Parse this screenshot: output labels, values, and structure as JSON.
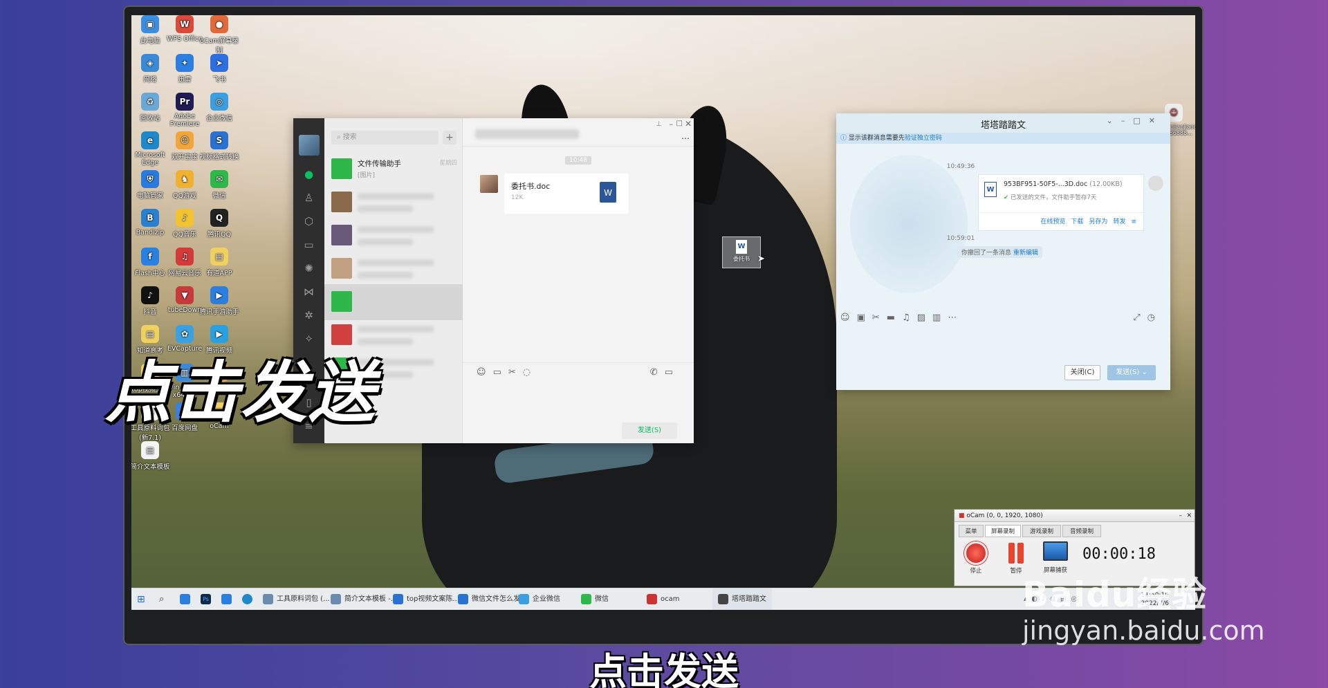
{
  "desktop_icons": [
    {
      "label": "此电脑",
      "color": "#3b8de0",
      "glyph": "▣"
    },
    {
      "label": "WPS Office",
      "color": "#d94a3a",
      "glyph": "W"
    },
    {
      "label": "oCam屏幕录制",
      "color": "#e06a3a",
      "glyph": "●"
    },
    {
      "label": "网络",
      "color": "#3a8ad8",
      "glyph": "◈"
    },
    {
      "label": "迅雷",
      "color": "#2a7fe0",
      "glyph": "✦"
    },
    {
      "label": "飞书",
      "color": "#2d6fe0",
      "glyph": "➤"
    },
    {
      "label": "回收站",
      "color": "#6aa8d8",
      "glyph": "♻"
    },
    {
      "label": "Adobe Premiere",
      "color": "#1f1b55",
      "glyph": "Pr"
    },
    {
      "label": "企业微信",
      "color": "#3a9ee0",
      "glyph": "◎"
    },
    {
      "label": "Microsoft Edge",
      "color": "#1e88c8",
      "glyph": "e"
    },
    {
      "label": "双开宝宝",
      "color": "#f2a53a",
      "glyph": "☺"
    },
    {
      "label": "视频格式转换",
      "color": "#2a72d0",
      "glyph": "S"
    },
    {
      "label": "电脑管家",
      "color": "#2a7be0",
      "glyph": "⛨"
    },
    {
      "label": "QQ游戏",
      "color": "#f0b030",
      "glyph": "♞"
    },
    {
      "label": "微信",
      "color": "#2fb84a",
      "glyph": "✉"
    },
    {
      "label": "Bandizip",
      "color": "#2a7fd0",
      "glyph": "B"
    },
    {
      "label": "QQ音乐",
      "color": "#f2c230",
      "glyph": "♪"
    },
    {
      "label": "腾讯QQ",
      "color": "#222",
      "glyph": "Q"
    },
    {
      "label": "Flash中心",
      "color": "#2a80e0",
      "glyph": "f"
    },
    {
      "label": "网易云音乐",
      "color": "#d33a3a",
      "glyph": "♫"
    },
    {
      "label": "有道APP",
      "color": "#f0d060",
      "glyph": "▤"
    },
    {
      "label": "抖音",
      "color": "#111",
      "glyph": "♪"
    },
    {
      "label": "tubeDown",
      "color": "#c83a3a",
      "glyph": "▼"
    },
    {
      "label": "腾讯手游助手",
      "color": "#2a7fe0",
      "glyph": "▶"
    },
    {
      "label": "知道高考",
      "color": "#f0d060",
      "glyph": "▤"
    },
    {
      "label": "EVCapture",
      "color": "#3aa0e0",
      "glyph": "✿"
    },
    {
      "label": "腾讯视频",
      "color": "#2aa0e0",
      "glyph": "▶"
    },
    {
      "label": "top视频文案",
      "color": "#f0d060",
      "glyph": "▤"
    },
    {
      "label": "Win 10 Pro x64 (C)",
      "color": "#3a8ad8",
      "glyph": "▥"
    },
    {
      "label": "腾讯影视库",
      "color": "#e0a030",
      "glyph": "▤"
    },
    {
      "label": "工具原料词包(新7.1)",
      "color": "#f4f4f4",
      "glyph": "▤"
    },
    {
      "label": "百度网盘",
      "color": "#3a80e0",
      "glyph": "☁"
    },
    {
      "label": "oCam",
      "color": "#f0d060",
      "glyph": "▤"
    },
    {
      "label": "简介文本模板",
      "color": "#f4f4f4",
      "glyph": "▤"
    }
  ],
  "wechat": {
    "search_placeholder": "搜索",
    "add_button": "+",
    "contacts": [
      {
        "name": "文件传输助手",
        "preview": "[图片]",
        "time": "星期四"
      },
      {
        "name": "",
        "preview": "",
        "time": ""
      },
      {
        "name": "",
        "preview": "",
        "time": ""
      },
      {
        "name": "",
        "preview": "",
        "time": ""
      },
      {
        "name": "",
        "preview": "",
        "time": ""
      },
      {
        "name": "",
        "preview": "",
        "time": ""
      },
      {
        "name": "",
        "preview": "",
        "time": ""
      }
    ],
    "message_time": "10:48",
    "file": {
      "name": "委托书.doc",
      "size": "12K"
    },
    "send_button": "发送(S)"
  },
  "dragged_file": {
    "label": "委托书"
  },
  "qq": {
    "title": "塔塔踏踏文",
    "notice_prefix": "显示该群消息需要先",
    "notice_link": "验证独立密码",
    "time1": "10:49:36",
    "file_name": "953BF951-50F5-...3D.doc",
    "file_size": "(12.00KB)",
    "file_status": "已发送的文件，文件助手暂存7天",
    "actions": [
      "在线预览",
      "下载",
      "另存为",
      "转发"
    ],
    "time2": "10:59:01",
    "recall_text": "你撤回了一条消息",
    "re_edit": "重新编辑",
    "close_button": "关闭(C)",
    "send_button": "发送(S)"
  },
  "ocam": {
    "title": "oCam (0, 0, 1920, 1080)",
    "tabs": [
      "菜单",
      "屏幕录制",
      "游戏录制",
      "音频录制"
    ],
    "buttons": [
      "停止",
      "暂停",
      "屏幕捕获"
    ],
    "timer": "00:00:18"
  },
  "taskbar": {
    "items": [
      "工具原料词包 (...",
      "简介文本模板 -...",
      "top视频文案陈...",
      "微信文件怎么发...",
      "企业微信",
      "微信",
      "ocam",
      "塔塔踏踏文"
    ],
    "clock_time": "11:50:10",
    "clock_date": "2022/7/6"
  },
  "right_desktop_label": "shikuanjianjiancai 10b786888...",
  "caption_big": "点击发送",
  "caption_sub": "点击发送",
  "watermark": {
    "brand": "Baidu经验",
    "url": "jingyan.baidu.com"
  }
}
